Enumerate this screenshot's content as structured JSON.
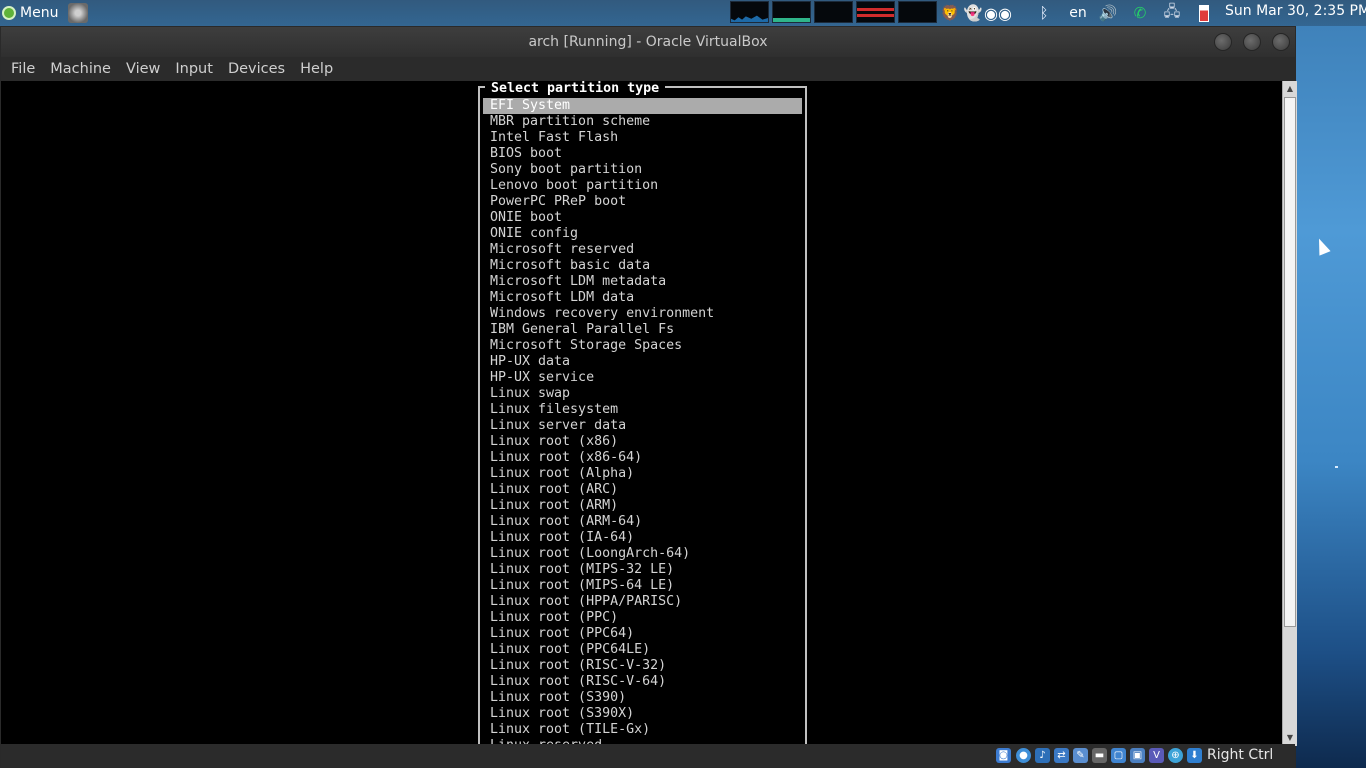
{
  "top_panel": {
    "menu_label": "Menu",
    "keyboard_layout": "en",
    "clock": "Sun Mar 30, 2:35 PM",
    "icons": [
      "system-monitor-icon",
      "brave-icon",
      "ghost-icon",
      "eyes-icon",
      "bluetooth-icon",
      "volume-icon",
      "whatsapp-icon",
      "network-icon",
      "battery-icon"
    ]
  },
  "window": {
    "title": "arch  [Running] - Oracle VirtualBox",
    "menu": [
      "File",
      "Machine",
      "View",
      "Input",
      "Devices",
      "Help"
    ]
  },
  "dialog": {
    "title": "Select partition type",
    "selected_index": 0,
    "items": [
      "EFI System",
      "MBR partition scheme",
      "Intel Fast Flash",
      "BIOS boot",
      "Sony boot partition",
      "Lenovo boot partition",
      "PowerPC PReP boot",
      "ONIE boot",
      "ONIE config",
      "Microsoft reserved",
      "Microsoft basic data",
      "Microsoft LDM metadata",
      "Microsoft LDM data",
      "Windows recovery environment",
      "IBM General Parallel Fs",
      "Microsoft Storage Spaces",
      "HP-UX data",
      "HP-UX service",
      "Linux swap",
      "Linux filesystem",
      "Linux server data",
      "Linux root (x86)",
      "Linux root (x86-64)",
      "Linux root (Alpha)",
      "Linux root (ARC)",
      "Linux root (ARM)",
      "Linux root (ARM-64)",
      "Linux root (IA-64)",
      "Linux root (LoongArch-64)",
      "Linux root (MIPS-32 LE)",
      "Linux root (MIPS-64 LE)",
      "Linux root (HPPA/PARISC)",
      "Linux root (PPC)",
      "Linux root (PPC64)",
      "Linux root (PPC64LE)",
      "Linux root (RISC-V-32)",
      "Linux root (RISC-V-64)",
      "Linux root (S390)",
      "Linux root (S390X)",
      "Linux root (TILE-Gx)",
      "Linux reserved"
    ]
  },
  "statusbar": {
    "host_key": "Right Ctrl"
  },
  "colors": {
    "selection": "#ababab",
    "terminal_bg": "#000000",
    "titlebar": "#3a3a3a"
  }
}
